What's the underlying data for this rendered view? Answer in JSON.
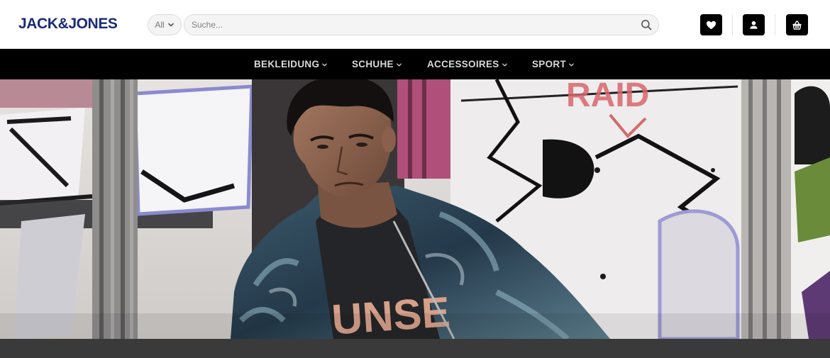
{
  "header": {
    "logo": "JACK&JONES",
    "category_select": {
      "value": "All",
      "icon": "chevron-down-icon"
    },
    "search": {
      "placeholder": "Suche...",
      "value": "",
      "icon": "search-icon"
    },
    "actions": [
      {
        "name": "wishlist",
        "icon": "heart-icon"
      },
      {
        "name": "account",
        "icon": "user-icon"
      },
      {
        "name": "cart",
        "icon": "basket-icon"
      }
    ]
  },
  "nav": {
    "items": [
      {
        "label": "BEKLEIDUNG",
        "icon": "chevron-down-icon"
      },
      {
        "label": "SCHUHE",
        "icon": "chevron-down-icon"
      },
      {
        "label": "ACCESSOIRES",
        "icon": "chevron-down-icon"
      },
      {
        "label": "SPORT",
        "icon": "chevron-down-icon"
      }
    ]
  },
  "hero": {
    "graffiti_text": "RAID",
    "shirt_text": "UNSE"
  },
  "colors": {
    "brand": "#1a2b78",
    "nav_background": "#000000",
    "nav_text": "#d8d8d8",
    "icon_button": "#000000",
    "footer_strip": "#3a3a3a"
  }
}
